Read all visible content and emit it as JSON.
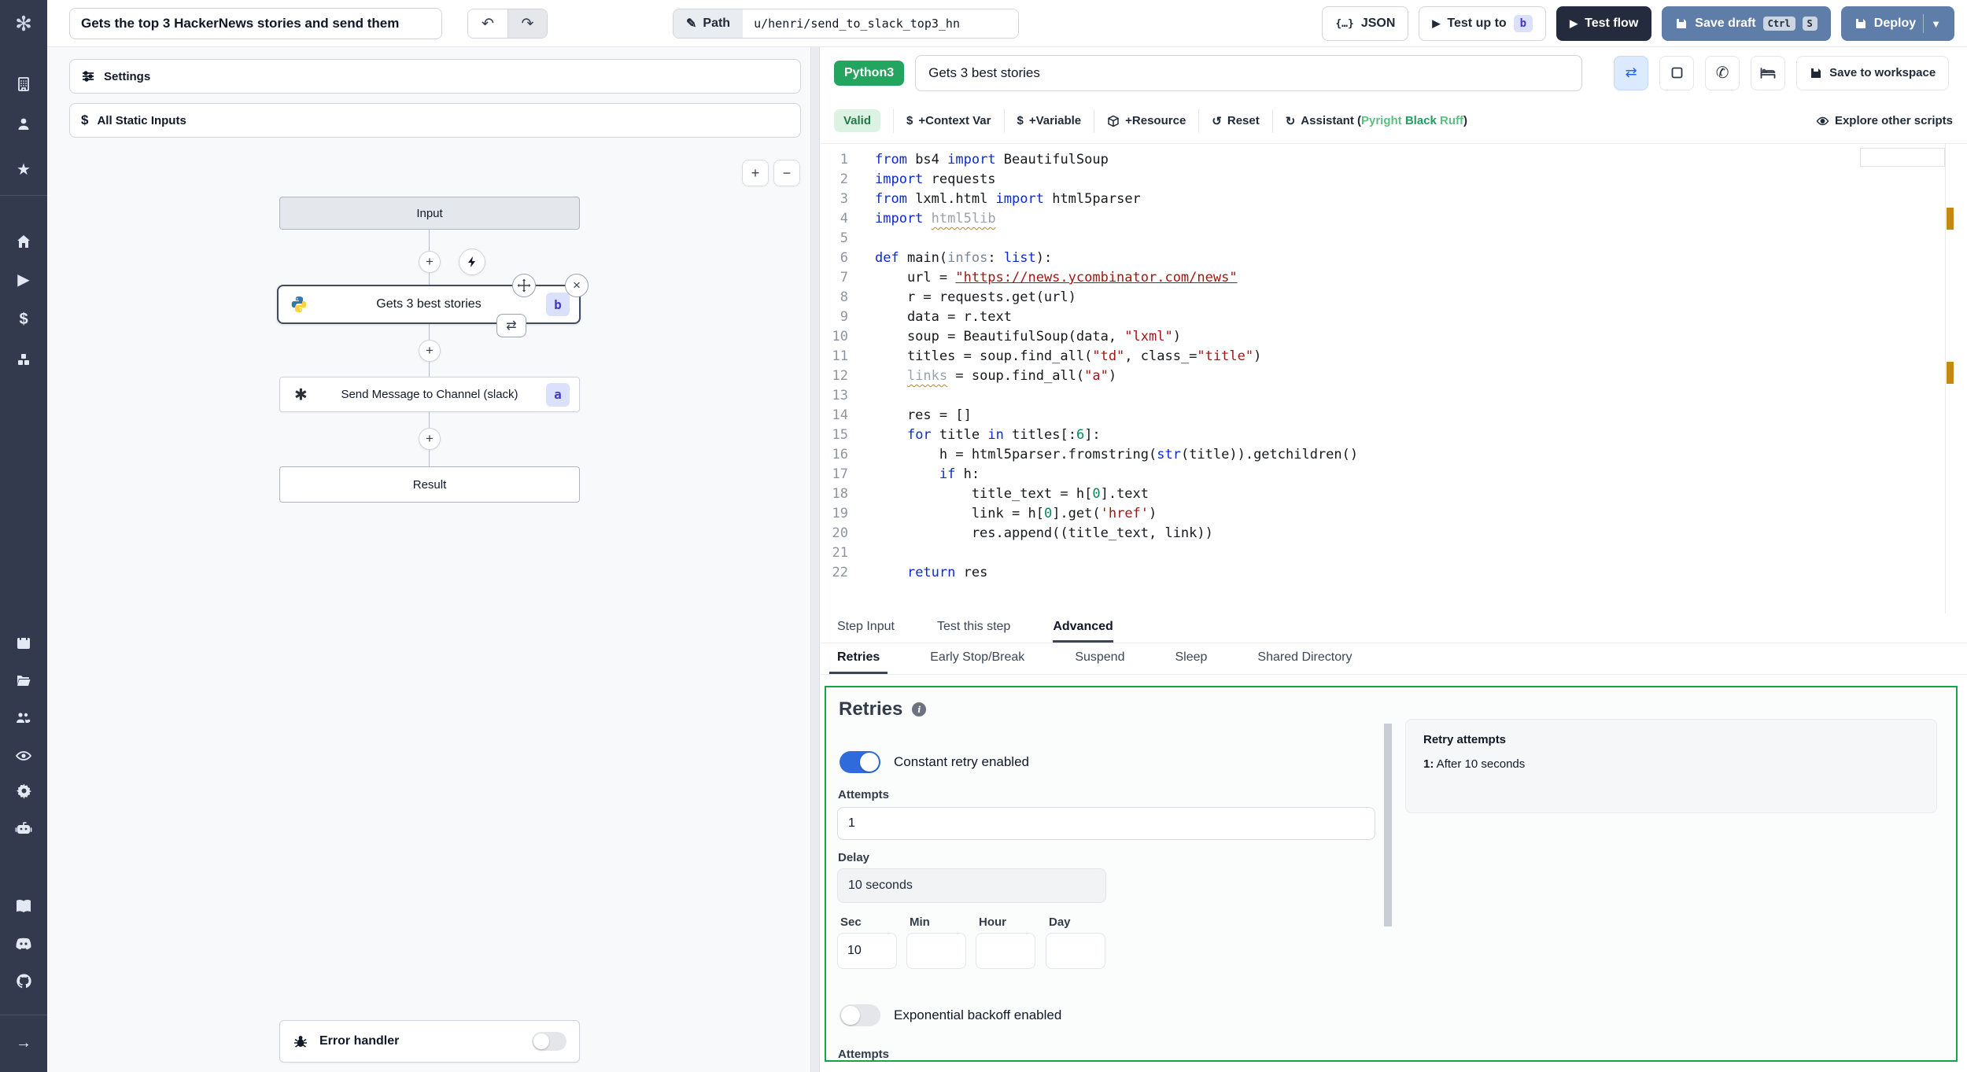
{
  "topbar": {
    "flow_title": "Gets the top 3 HackerNews stories and send them",
    "path_label": "Path",
    "path_value": "u/henri/send_to_slack_top3_hn",
    "json_label": "JSON",
    "test_up_to_label": "Test up to",
    "test_up_to_target": "b",
    "test_flow_label": "Test flow",
    "save_draft_label": "Save draft",
    "save_draft_kbd": [
      "Ctrl",
      "S"
    ],
    "deploy_label": "Deploy"
  },
  "flow": {
    "settings_label": "Settings",
    "static_inputs_label": "All Static Inputs",
    "zoom_in": "+",
    "zoom_out": "−",
    "input_node": "Input",
    "step_b_title": "Gets 3 best stories",
    "step_b_id": "b",
    "step_a_title": "Send Message to Channel (slack)",
    "step_a_id": "a",
    "result_node": "Result",
    "error_handler_label": "Error handler"
  },
  "editor": {
    "lang_badge": "Python3",
    "step_name": "Gets 3 best stories",
    "save_to_workspace": "Save to workspace",
    "valid_badge": "Valid",
    "add_context_var": "+Context Var",
    "add_variable": "+Variable",
    "add_resource": "+Resource",
    "reset_label": "Reset",
    "assistant_prefix": "Assistant (",
    "assistant_tools": [
      "Pyright",
      "Black",
      "Ruff"
    ],
    "assistant_suffix": ")",
    "explore_label": "Explore other scripts"
  },
  "code": {
    "lines": [
      [
        [
          "k",
          "from"
        ],
        [
          "d",
          " bs4 "
        ],
        [
          "k",
          "import"
        ],
        [
          "d",
          " BeautifulSoup"
        ]
      ],
      [
        [
          "k",
          "import"
        ],
        [
          "d",
          " requests"
        ]
      ],
      [
        [
          "k",
          "from"
        ],
        [
          "d",
          " lxml.html "
        ],
        [
          "k",
          "import"
        ],
        [
          "d",
          " html5parser"
        ]
      ],
      [
        [
          "k",
          "import"
        ],
        [
          "d",
          " "
        ],
        [
          "g",
          "html5lib"
        ]
      ],
      [],
      [
        [
          "k",
          "def"
        ],
        [
          "d",
          " main("
        ],
        [
          "p",
          "infos"
        ],
        [
          "d",
          ": "
        ],
        [
          "k",
          "list"
        ],
        [
          "d",
          "):"
        ]
      ],
      [
        [
          "d",
          "    url = "
        ],
        [
          "u",
          "\"https://news.ycombinator.com/news\""
        ]
      ],
      [
        [
          "d",
          "    r = requests.get(url)"
        ]
      ],
      [
        [
          "d",
          "    data = r.text"
        ]
      ],
      [
        [
          "d",
          "    soup = BeautifulSoup(data, "
        ],
        [
          "s",
          "\"lxml\""
        ],
        [
          "d",
          ")"
        ]
      ],
      [
        [
          "d",
          "    titles = soup.find_all("
        ],
        [
          "s",
          "\"td\""
        ],
        [
          "d",
          ", class_="
        ],
        [
          "s",
          "\"title\""
        ],
        [
          "d",
          ")"
        ]
      ],
      [
        [
          "d",
          "    "
        ],
        [
          "g",
          "links"
        ],
        [
          "d",
          " = soup.find_all("
        ],
        [
          "s",
          "\"a\""
        ],
        [
          "d",
          ")"
        ]
      ],
      [],
      [
        [
          "d",
          "    res = []"
        ]
      ],
      [
        [
          "d",
          "    "
        ],
        [
          "k",
          "for"
        ],
        [
          "d",
          " title "
        ],
        [
          "k",
          "in"
        ],
        [
          "d",
          " titles[:"
        ],
        [
          "n",
          "6"
        ],
        [
          "d",
          "]:"
        ]
      ],
      [
        [
          "d",
          "        h = html5parser.fromstring("
        ],
        [
          "k",
          "str"
        ],
        [
          "d",
          "(title)).getchildren()"
        ]
      ],
      [
        [
          "d",
          "        "
        ],
        [
          "k",
          "if"
        ],
        [
          "d",
          " h:"
        ]
      ],
      [
        [
          "d",
          "            title_text = h["
        ],
        [
          "n",
          "0"
        ],
        [
          "d",
          "].text"
        ]
      ],
      [
        [
          "d",
          "            link = h["
        ],
        [
          "n",
          "0"
        ],
        [
          "d",
          "].get("
        ],
        [
          "s",
          "'href'"
        ],
        [
          "d",
          ")"
        ]
      ],
      [
        [
          "d",
          "            res.append((title_text, link))"
        ]
      ],
      [],
      [
        [
          "d",
          "    "
        ],
        [
          "k",
          "return"
        ],
        [
          "d",
          " res"
        ]
      ]
    ]
  },
  "tabs": {
    "main": [
      "Step Input",
      "Test this step",
      "Advanced"
    ],
    "active_main": "Advanced",
    "sub": [
      "Retries",
      "Early Stop/Break",
      "Suspend",
      "Sleep",
      "Shared Directory"
    ],
    "active_sub": "Retries"
  },
  "retries": {
    "title": "Retries",
    "constant_toggle_label": "Constant retry enabled",
    "attempts_label": "Attempts",
    "attempts_value": "1",
    "delay_label": "Delay",
    "delay_value": "10 seconds",
    "units": [
      "Sec",
      "Min",
      "Hour",
      "Day"
    ],
    "sec_value": "10",
    "min_value": "",
    "hour_value": "",
    "day_value": "",
    "exponential_toggle_label": "Exponential backoff enabled",
    "attempts2_label": "Attempts",
    "summary_title": "Retry attempts",
    "summary_bold": "1:",
    "summary_text": " After 10 seconds"
  },
  "colors": {
    "rail_bg": "#333a4d",
    "dark_button": "#232b3c",
    "steel_button": "#5f7da9",
    "badge_bg": "#dbe0fd",
    "badge_text": "#4338ca",
    "python_badge": "#23a55f",
    "valid_bg": "#dcf2e3",
    "valid_text": "#217a4b",
    "toggle_on": "#2f6bdb",
    "panel_border": "#16a34a",
    "warning_marker": "#c18a10"
  }
}
